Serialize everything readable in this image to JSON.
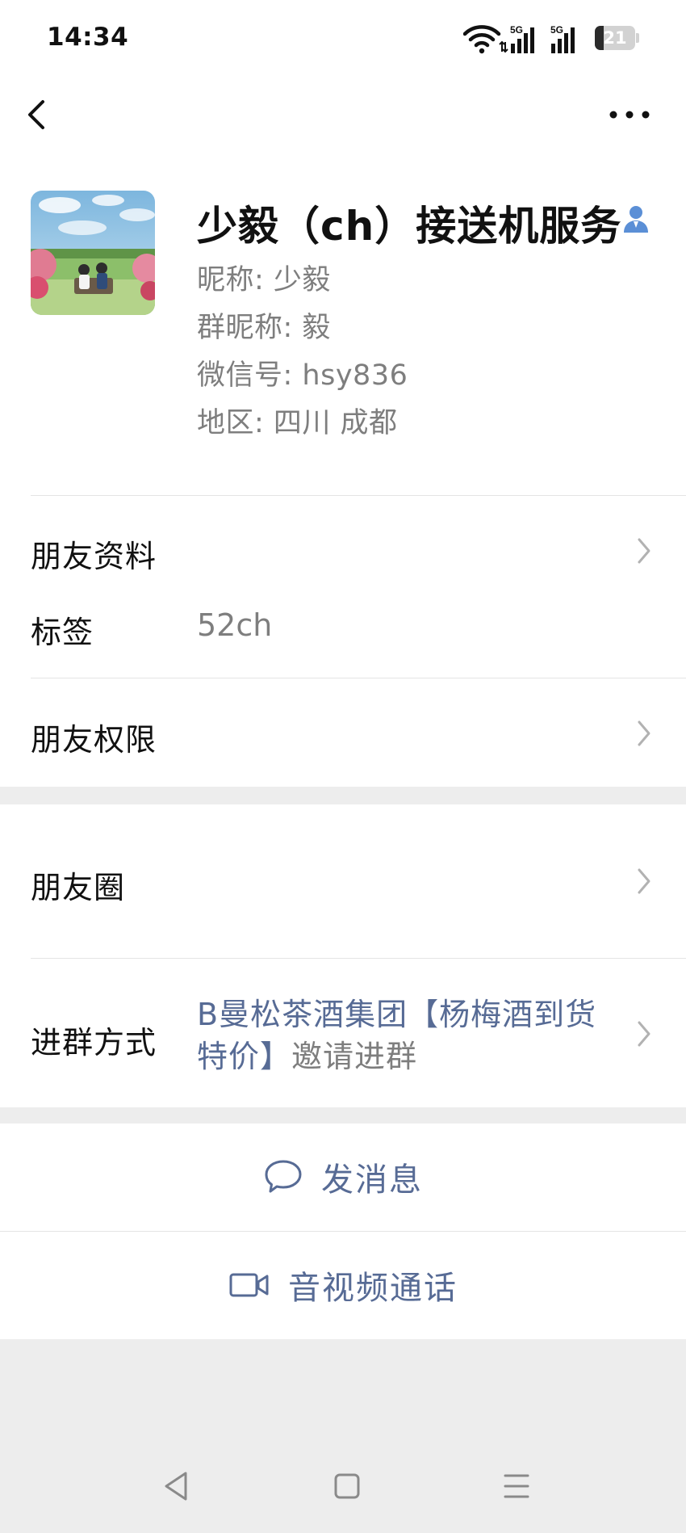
{
  "status_bar": {
    "time": "14:34",
    "signal_1": "5G",
    "signal_2": "5G",
    "battery": "21",
    "battery_level": 0.21
  },
  "nav": {
    "back_icon": "chevron-left-icon",
    "more_icon": "ellipsis-icon"
  },
  "profile": {
    "name": "少毅（ch）接送机服务",
    "nickname": "昵称:  少毅",
    "group_nickname": "群昵称:  毅",
    "wechat_id": "微信号:  hsy836",
    "region": "地区:  四川  成都"
  },
  "rows": {
    "friend_profile": "朋友资料",
    "tag_label": "标签",
    "tag_value": "52ch",
    "friend_permissions": "朋友权限",
    "moments": "朋友圈",
    "join_method_label": "进群方式",
    "join_method_link": "B曼松茶酒集团【杨梅酒到货特价】",
    "join_method_suffix": "邀请进群"
  },
  "actions": {
    "message": "发消息",
    "call": "音视频通话"
  },
  "colors": {
    "link": "#576b95",
    "secondary_text": "#7e7e7e",
    "gap_bg": "#ededed",
    "badge": "#5b8fd6"
  }
}
